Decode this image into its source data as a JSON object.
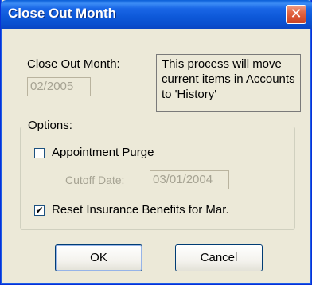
{
  "window": {
    "title": "Close Out Month",
    "close_glyph": "✕"
  },
  "close_out": {
    "label": "Close Out Month:",
    "value": "02/2005",
    "info_text": "This process will move current items in Accounts to 'History'"
  },
  "options": {
    "title": "Options:",
    "appointment_purge": {
      "label": "Appointment Purge",
      "checked": false,
      "glyph": ""
    },
    "cutoff": {
      "label": "Cutoff Date:",
      "value": "03/01/2004"
    },
    "reset_benefits": {
      "label": "Reset Insurance Benefits for Mar.",
      "checked": true,
      "glyph": "✔"
    }
  },
  "buttons": {
    "ok": "OK",
    "cancel": "Cancel"
  },
  "colors": {
    "title_bar": "#0a5fd8",
    "dialog_bg": "#ece9d8",
    "close_button": "#d8512f",
    "disabled_text": "#a6a393"
  }
}
